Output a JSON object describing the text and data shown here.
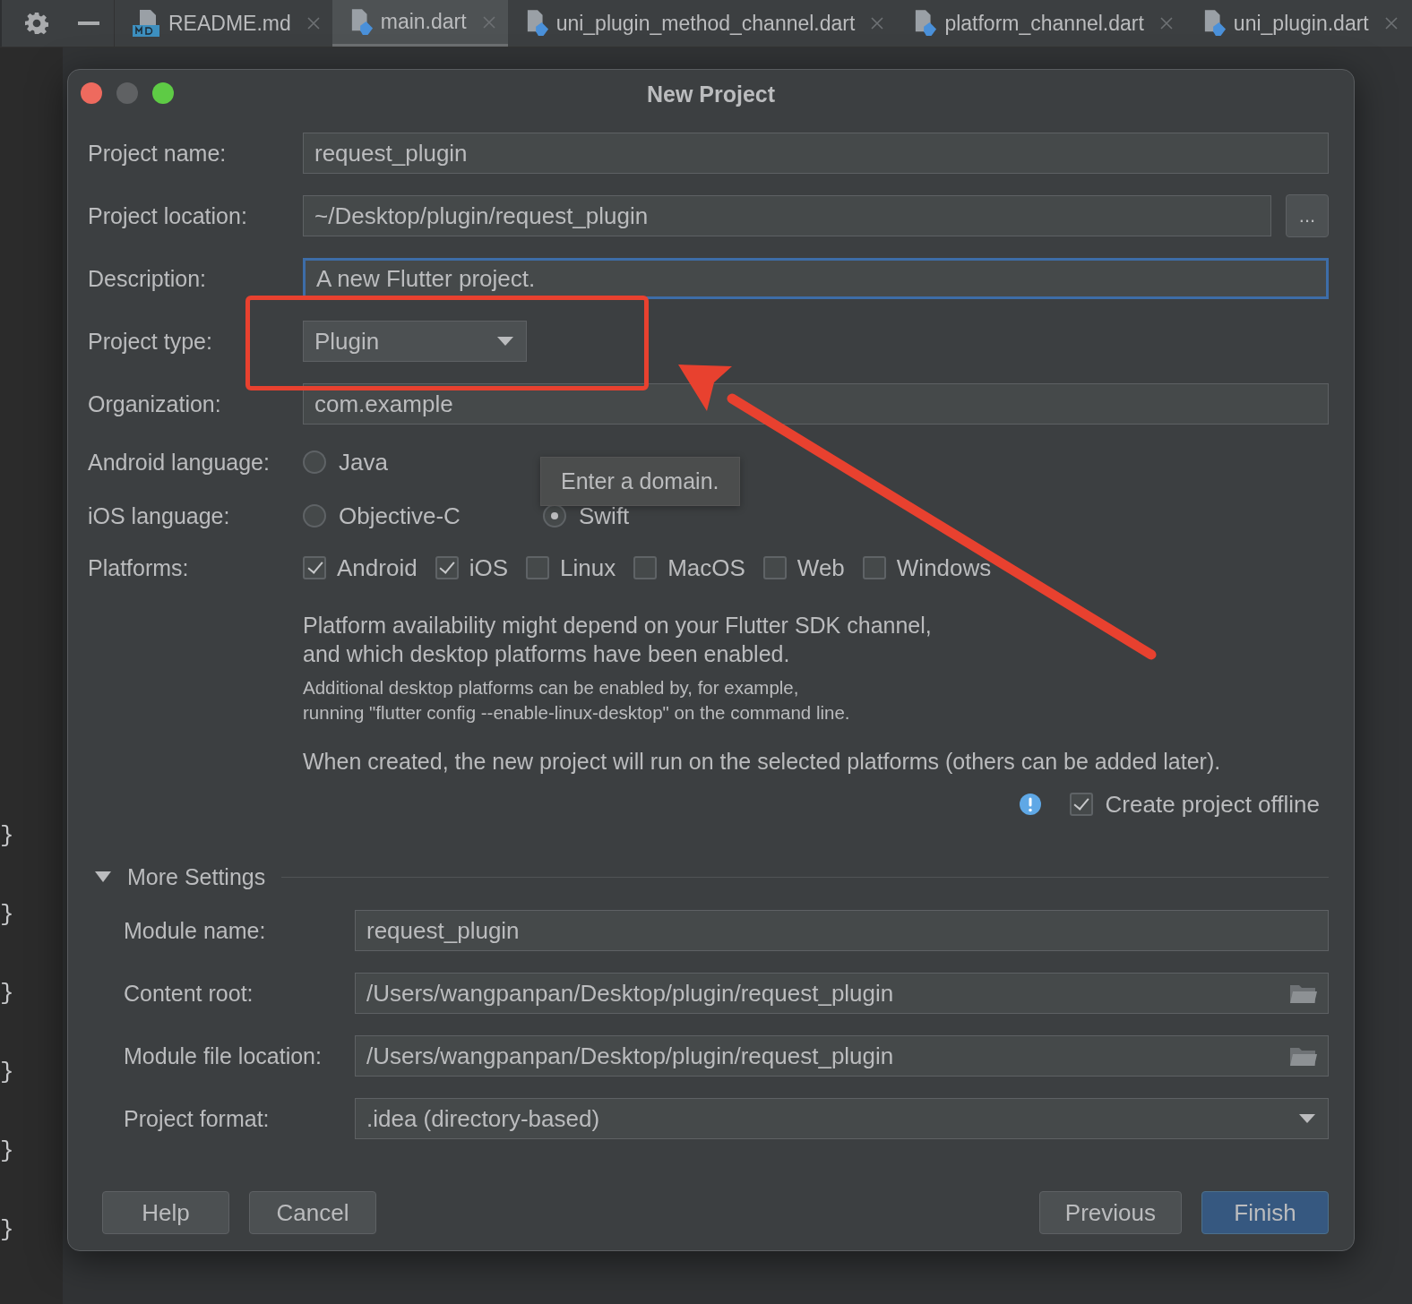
{
  "ide": {
    "tabs": [
      {
        "label": "README.md",
        "kind": "markdown",
        "selected": false
      },
      {
        "label": "main.dart",
        "kind": "dart",
        "selected": true
      },
      {
        "label": "uni_plugin_method_channel.dart",
        "kind": "dart",
        "selected": false
      },
      {
        "label": "platform_channel.dart",
        "kind": "dart",
        "selected": false
      },
      {
        "label": "uni_plugin.dart",
        "kind": "dart",
        "selected": false
      }
    ],
    "code_fragments": [
      "}",
      "}",
      "}",
      "}",
      "}",
      "}"
    ]
  },
  "dialog": {
    "title": "New Project",
    "fields": [
      {
        "label": "Project name:",
        "value": "request_plugin",
        "kind": "text",
        "focused": false
      },
      {
        "label": "Project location:",
        "value": "~/Desktop/plugin/request_plugin",
        "kind": "browse",
        "button": "...",
        "focused": false
      },
      {
        "label": "Description:",
        "value": "A new Flutter project.",
        "kind": "text",
        "focused": true
      },
      {
        "label": "Project type:",
        "value": "Plugin",
        "kind": "dropdown"
      },
      {
        "label": "Organization:",
        "value": "com.example",
        "kind": "text",
        "focused": false
      }
    ],
    "languages": [
      {
        "label": "Android language:",
        "options": [
          {
            "label": "Java",
            "selected": false
          }
        ]
      },
      {
        "label": "iOS language:",
        "options": [
          {
            "label": "Objective-C",
            "selected": false
          },
          {
            "label": "Swift",
            "selected": true
          }
        ]
      }
    ],
    "tooltip": "Enter a domain.",
    "platforms": {
      "label": "Platforms:",
      "items": [
        {
          "label": "Android",
          "checked": true
        },
        {
          "label": "iOS",
          "checked": true
        },
        {
          "label": "Linux",
          "checked": false
        },
        {
          "label": "MacOS",
          "checked": false
        },
        {
          "label": "Web",
          "checked": false
        },
        {
          "label": "Windows",
          "checked": false
        }
      ]
    },
    "notes": [
      {
        "kind": "large",
        "lines": [
          "Platform availability might depend on your Flutter SDK channel,",
          "and which desktop platforms have been enabled."
        ]
      },
      {
        "kind": "small",
        "lines": [
          "Additional desktop platforms can be enabled by, for example,",
          "running \"flutter config --enable-linux-desktop\" on the command line."
        ]
      },
      {
        "kind": "large",
        "lines": [
          "When created, the new project will run on the selected platforms (others can be added later)."
        ]
      }
    ],
    "offline": {
      "label": "Create project offline",
      "checked": true
    },
    "more_settings": {
      "label": "More Settings",
      "expanded": true,
      "fields": [
        {
          "label": "Module name:",
          "value": "request_plugin",
          "kind": "text"
        },
        {
          "label": "Content root:",
          "value": "/Users/wangpanpan/Desktop/plugin/request_plugin",
          "kind": "folder"
        },
        {
          "label": "Module file location:",
          "value": "/Users/wangpanpan/Desktop/plugin/request_plugin",
          "kind": "folder"
        },
        {
          "label": "Project format:",
          "value": ".idea (directory-based)",
          "kind": "dropdown"
        }
      ]
    },
    "left_buttons": [
      {
        "label": "Help",
        "primary": false
      },
      {
        "label": "Cancel",
        "primary": false
      }
    ],
    "right_buttons": [
      {
        "label": "Previous",
        "primary": false
      },
      {
        "label": "Finish",
        "primary": true
      }
    ]
  }
}
